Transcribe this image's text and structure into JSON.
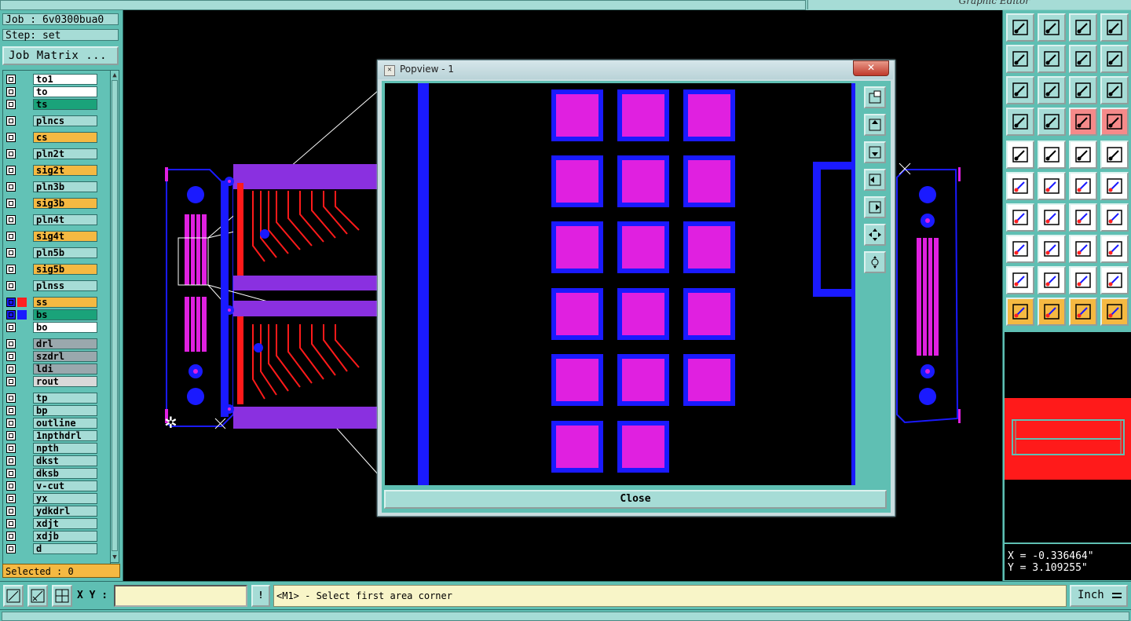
{
  "window": {
    "title": "Graphic Editor"
  },
  "job": {
    "label": "Job : 6v0300bua0",
    "step": "Step: set"
  },
  "job_matrix_button": "Job Matrix ...",
  "layers": [
    {
      "name": "to1",
      "color": "#ffffff"
    },
    {
      "name": "to",
      "color": "#ffffff"
    },
    {
      "name": "ts",
      "color": "#1aa37a"
    },
    {
      "name": "plncs",
      "color": "#a6dcd6"
    },
    {
      "name": "cs",
      "color": "#f5b942"
    },
    {
      "name": "pln2t",
      "color": "#a6dcd6"
    },
    {
      "name": "sig2t",
      "color": "#f5b942"
    },
    {
      "name": "pln3b",
      "color": "#a6dcd6"
    },
    {
      "name": "sig3b",
      "color": "#f5b942"
    },
    {
      "name": "pln4t",
      "color": "#a6dcd6"
    },
    {
      "name": "sig4t",
      "color": "#f5b942"
    },
    {
      "name": "pln5b",
      "color": "#a6dcd6"
    },
    {
      "name": "sig5b",
      "color": "#f5b942"
    },
    {
      "name": "plnss",
      "color": "#a6dcd6"
    },
    {
      "name": "ss",
      "color": "#f5b942",
      "swatch": "#ff2020",
      "active": true
    },
    {
      "name": "bs",
      "color": "#1aa37a",
      "swatch": "#1a1aff",
      "active": true
    },
    {
      "name": "bo",
      "color": "#ffffff"
    },
    {
      "name": "drl",
      "color": "#9aa8ad"
    },
    {
      "name": "szdrl",
      "color": "#9aa8ad"
    },
    {
      "name": "ldi",
      "color": "#9aa8ad"
    },
    {
      "name": "rout",
      "color": "#d9d9d9"
    },
    {
      "name": "tp",
      "color": "#a6dcd6"
    },
    {
      "name": "bp",
      "color": "#a6dcd6"
    },
    {
      "name": "outline",
      "color": "#a6dcd6"
    },
    {
      "name": "1npthdrl",
      "color": "#a6dcd6"
    },
    {
      "name": "npth",
      "color": "#a6dcd6"
    },
    {
      "name": "dkst",
      "color": "#a6dcd6"
    },
    {
      "name": "dksb",
      "color": "#a6dcd6"
    },
    {
      "name": "v-cut",
      "color": "#a6dcd6"
    },
    {
      "name": "yx",
      "color": "#a6dcd6"
    },
    {
      "name": "ydkdrl",
      "color": "#a6dcd6"
    },
    {
      "name": "xdjt",
      "color": "#a6dcd6"
    },
    {
      "name": "xdjb",
      "color": "#a6dcd6"
    },
    {
      "name": "d",
      "color": "#a6dcd6"
    }
  ],
  "selected_label": "Selected : 0",
  "popview": {
    "title": "Popview - 1",
    "close_x": "✕",
    "close_button": "Close"
  },
  "bottom": {
    "xy_label": "X Y :",
    "xy_value": "",
    "excl": "!",
    "prompt": "<M1> - Select first area corner",
    "units": "Inch"
  },
  "coords": {
    "x": "X = -0.336464\"",
    "y": "Y = 3.109255\""
  },
  "colors": {
    "panel": "#5fbfb3",
    "button": "#a6dcd6",
    "pad": "#e020e0",
    "trace": "#ff1a1a",
    "copper": "#1a1aff",
    "tool_orange": "#f5b942"
  }
}
